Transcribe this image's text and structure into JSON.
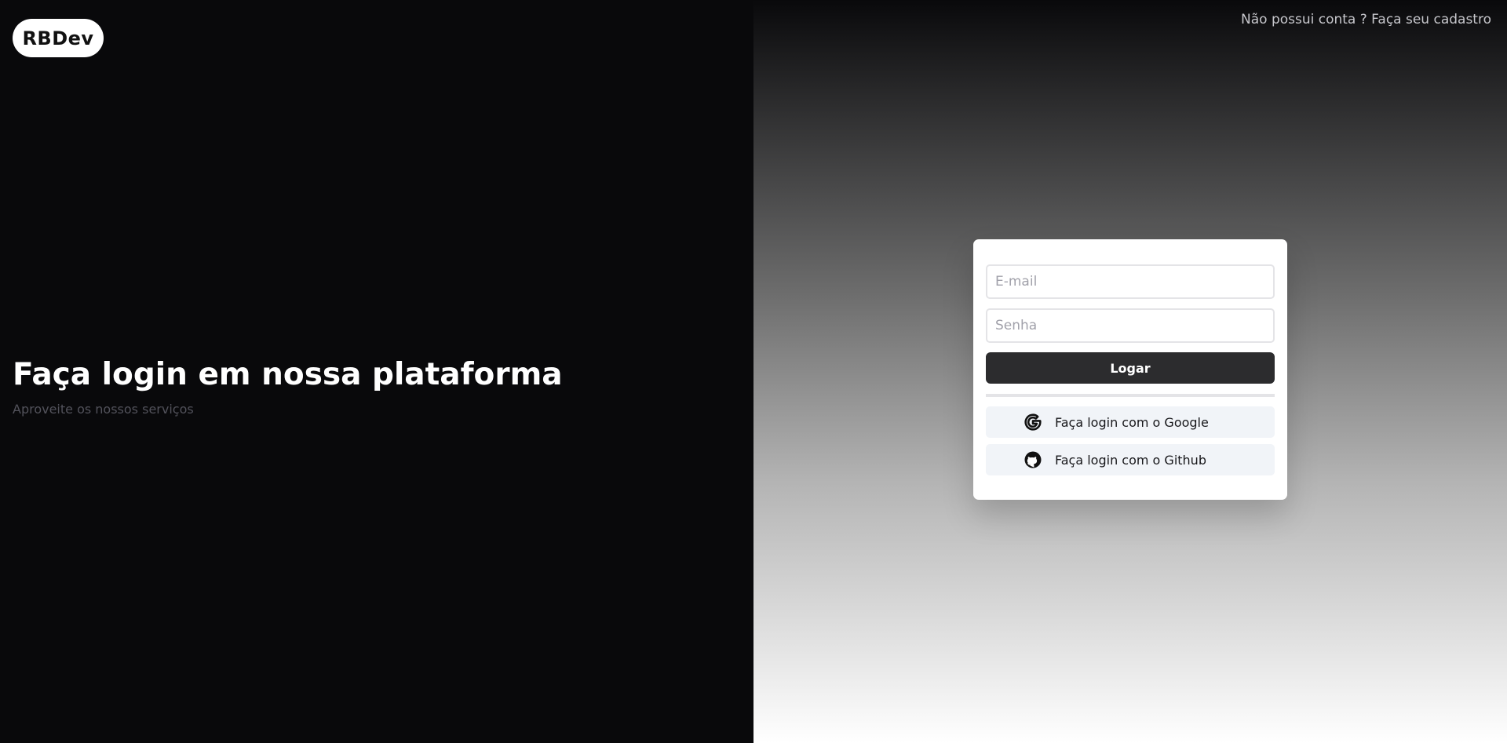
{
  "brand": {
    "name": "RBDev"
  },
  "hero": {
    "title": "Faça login em nossa plataforma",
    "subtitle": "Aproveite os nossos serviços"
  },
  "header": {
    "signup_link": "Não possui conta ? Faça seu cadastro"
  },
  "form": {
    "email_placeholder": "E-mail",
    "email_value": "",
    "password_placeholder": "Senha",
    "password_value": "",
    "submit_label": "Logar"
  },
  "social": [
    {
      "label": "Faça login com o Google",
      "icon": "google-icon"
    },
    {
      "label": "Faça login com o Github",
      "icon": "github-icon"
    }
  ],
  "colors": {
    "left_panel_bg": "#09090b",
    "primary_button": "#2c2c2e",
    "social_button_bg": "#f1f4f8"
  }
}
